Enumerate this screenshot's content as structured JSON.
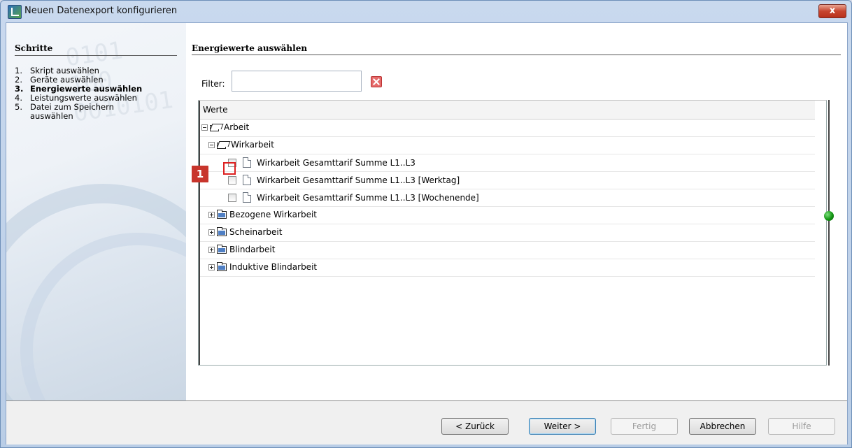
{
  "window": {
    "title": "Neuen Datenexport konfigurieren",
    "close_label": "x"
  },
  "steps": {
    "heading": "Schritte",
    "items": [
      {
        "num": "1.",
        "label": "Skript auswählen"
      },
      {
        "num": "2.",
        "label": "Geräte auswählen"
      },
      {
        "num": "3.",
        "label": "Energiewerte auswählen",
        "active": true
      },
      {
        "num": "4.",
        "label": "Leistungswerte auswählen"
      },
      {
        "num": "5.",
        "label": "Datei zum Speichern auswählen"
      }
    ],
    "decoration": "0101\n100\n0010101"
  },
  "main": {
    "heading": "Energiewerte auswählen",
    "filter": {
      "label": "Filter:",
      "value": "",
      "placeholder": ""
    },
    "tree": {
      "column_header": "Werte",
      "nodes": [
        {
          "label": "Arbeit"
        },
        {
          "label": "Wirkarbeit"
        },
        {
          "label": "Wirkarbeit Gesamttarif Summe L1..L3",
          "checked": false
        },
        {
          "label": "Wirkarbeit Gesamttarif Summe L1..L3 [Werktag]",
          "checked": false
        },
        {
          "label": "Wirkarbeit Gesamttarif Summe L1..L3 [Wochenende]",
          "checked": false
        },
        {
          "label": "Bezogene Wirkarbeit"
        },
        {
          "label": "Scheinarbeit"
        },
        {
          "label": "Blindarbeit"
        },
        {
          "label": "Induktive Blindarbeit"
        }
      ]
    },
    "callout_number": "1",
    "status_color": "#139513"
  },
  "buttons": {
    "back": "< Zurück",
    "next": "Weiter >",
    "finish": "Fertig",
    "cancel": "Abbrechen",
    "help": "Hilfe"
  }
}
